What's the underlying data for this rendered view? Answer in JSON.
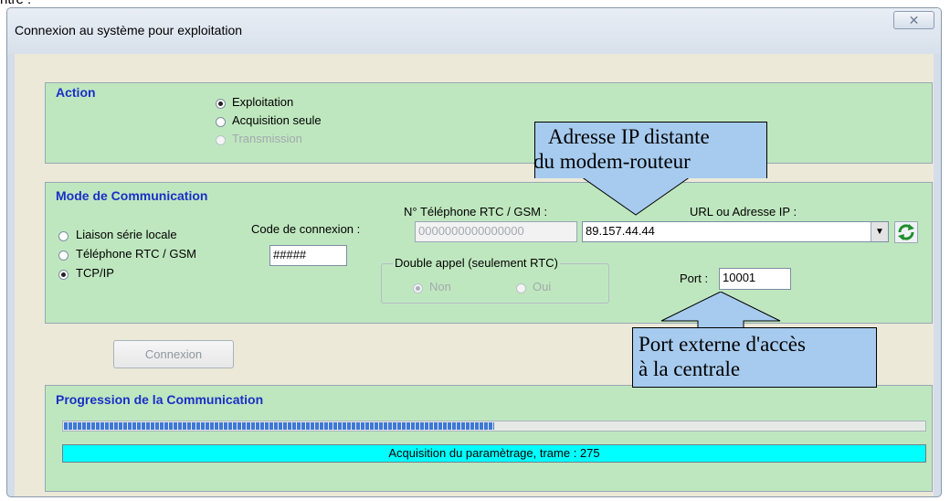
{
  "top_fragment": "ntre :",
  "window": {
    "title": "Connexion au système pour exploitation",
    "close_glyph": "☒"
  },
  "action_group": {
    "title": "Action",
    "options": [
      {
        "label": "Exploitation",
        "selected": true,
        "enabled": true
      },
      {
        "label": "Acquisition seule",
        "selected": false,
        "enabled": true
      },
      {
        "label": "Transmission",
        "selected": false,
        "enabled": false
      }
    ]
  },
  "mode_group": {
    "title": "Mode de Communication",
    "options": [
      {
        "label": "Liaison série locale",
        "selected": false
      },
      {
        "label": "Téléphone RTC / GSM",
        "selected": false
      },
      {
        "label": "TCP/IP",
        "selected": true
      }
    ],
    "code_label": "Code de connexion :",
    "code_value": "#####",
    "phone_label": "N° Téléphone RTC / GSM :",
    "phone_value": "0000000000000000",
    "url_label": "URL ou Adresse IP :",
    "url_value": "89.157.44.44",
    "double_call": {
      "label": "Double appel (seulement RTC)",
      "options": [
        {
          "label": "Non",
          "selected": true
        },
        {
          "label": "Oui",
          "selected": false
        }
      ]
    },
    "port_label": "Port :",
    "port_value": "10001"
  },
  "connect_button": "Connexion",
  "progress_group": {
    "title": "Progression de la Communication",
    "progress_fraction": 0.5,
    "status_text": "Acquisition du paramètrage, trame : 275"
  },
  "callouts": {
    "ip": {
      "line1": "Adresse IP distante",
      "line2": "du modem-routeur"
    },
    "port": {
      "line1": "Port externe d'accès",
      "line2": "à la centrale"
    }
  },
  "colors": {
    "group_bg": "#bfe7bf",
    "group_title": "#1a2fc8",
    "progress_seg": "#3e78d6",
    "status_bar": "#00ffff",
    "callout_bg": "#a7cbef"
  },
  "icons": {
    "refresh": "refresh-icon",
    "dropdown": "chevron-down-icon"
  }
}
